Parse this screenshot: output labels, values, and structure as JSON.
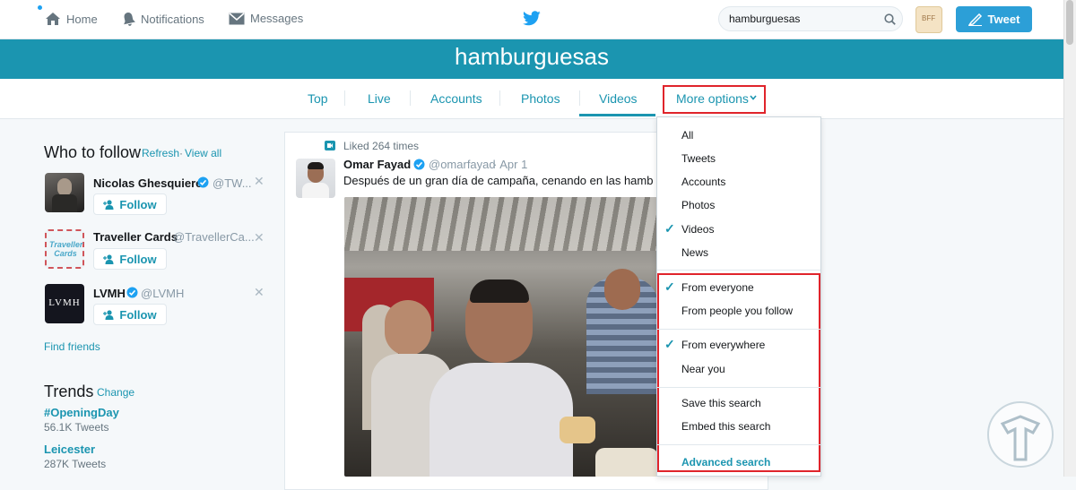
{
  "nav": {
    "home": "Home",
    "notifications": "Notifications",
    "messages": "Messages",
    "tweet_button": "Tweet",
    "avatar_text": "BFF"
  },
  "search": {
    "value": "hamburguesas"
  },
  "page_title": "hamburguesas",
  "tabs": [
    {
      "label": "Top"
    },
    {
      "label": "Live"
    },
    {
      "label": "Accounts"
    },
    {
      "label": "Photos"
    },
    {
      "label": "Videos"
    },
    {
      "label": "More options"
    }
  ],
  "who_to_follow": {
    "title": "Who to follow",
    "refresh": "Refresh",
    "view_all": "View all",
    "dot": "·",
    "follow_label": "Follow",
    "users": [
      {
        "name": "Nicolas Ghesquiere",
        "handle": "@TW..."
      },
      {
        "name": "Traveller Cards",
        "handle": "@TravellerCa..."
      },
      {
        "name": "LVMH",
        "handle": "@LVMH",
        "avatar_text": "LVMH"
      }
    ],
    "traveller_logo": "Traveller Cards",
    "find_friends": "Find friends"
  },
  "trends": {
    "title": "Trends",
    "dot": "·",
    "change": "Change",
    "items": [
      {
        "tag": "#OpeningDay",
        "count": "56.1K Tweets"
      },
      {
        "tag": "Leicester",
        "count": "287K Tweets"
      }
    ]
  },
  "tweet": {
    "context": "Liked 264 times",
    "name": "Omar Fayad",
    "handle": "@omarfayad",
    "time": "· Apr 1",
    "text": "Después de un gran día de campaña, cenando en las hamb"
  },
  "dropdown": {
    "items": [
      {
        "label": "All"
      },
      {
        "label": "Tweets"
      },
      {
        "label": "Accounts"
      },
      {
        "label": "Photos"
      },
      {
        "label": "Videos",
        "checked": true
      },
      {
        "label": "News"
      }
    ],
    "people": [
      {
        "label": "From everyone",
        "checked": true
      },
      {
        "label": "From people you follow"
      }
    ],
    "location": [
      {
        "label": "From everywhere",
        "checked": true
      },
      {
        "label": "Near you"
      }
    ],
    "actions": [
      {
        "label": "Save this search"
      },
      {
        "label": "Embed this search"
      }
    ],
    "advanced": "Advanced search"
  },
  "colors": {
    "accent": "#1b95b0",
    "highlight_red": "#e0242b",
    "tweet_blue": "#2c9fd7"
  }
}
